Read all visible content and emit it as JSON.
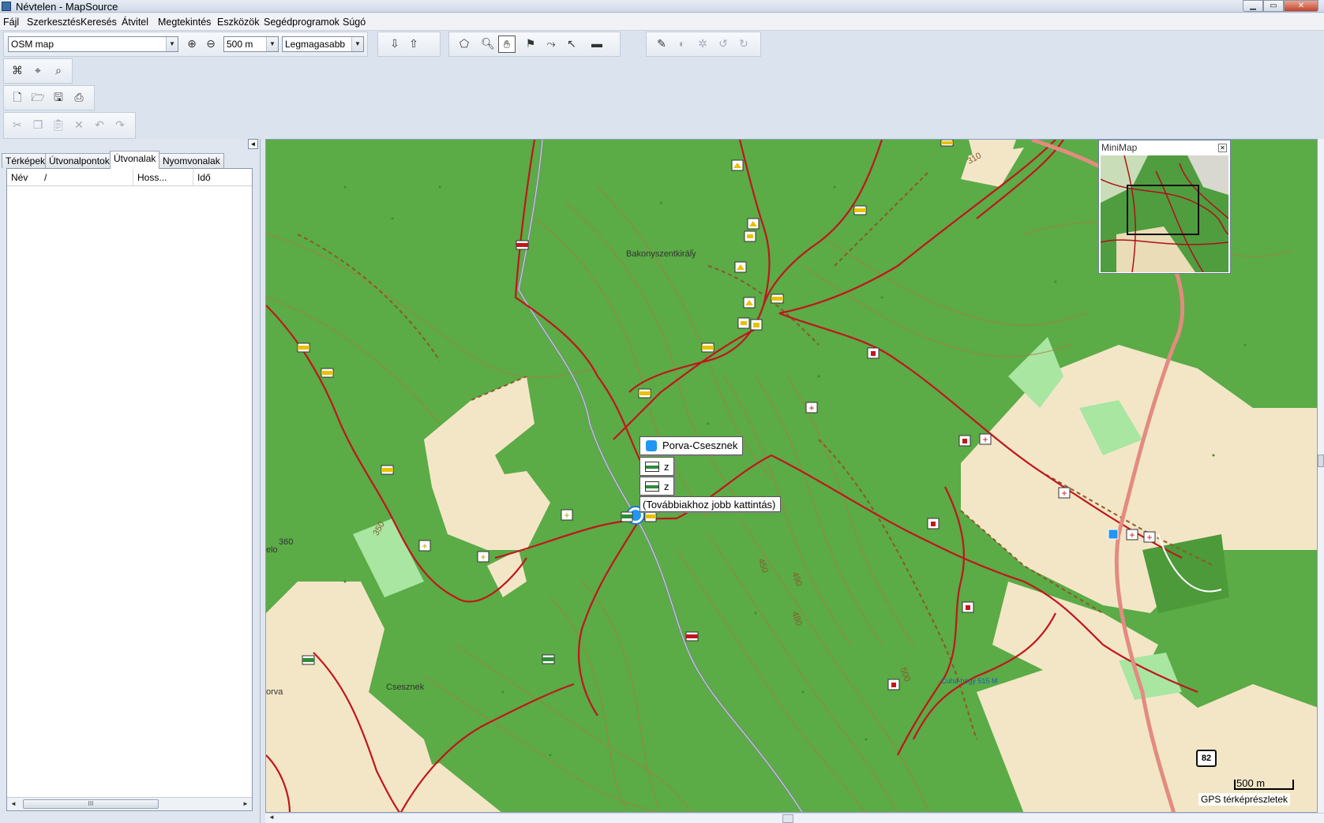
{
  "window": {
    "title": "Névtelen - MapSource",
    "min_glyph": "▁",
    "max_glyph": "▭",
    "close_glyph": "✕"
  },
  "menu": [
    "Fájl",
    "Szerkesztés",
    "Keresés",
    "Átvitel",
    "Megtekintés",
    "Eszközök",
    "Segédprogramok",
    "Súgó"
  ],
  "toolbar": {
    "map_product": "OSM map",
    "zoom_level": "500 m",
    "detail_level": "Legmagasabb",
    "combo_arrow": "▼"
  },
  "left_panel": {
    "collapse_glyph": "◄",
    "tabs": [
      "Térképek",
      "Útvonalpontok",
      "Útvonalak",
      "Nyomvonalak"
    ],
    "active_tab": 2,
    "columns": [
      "Név",
      "/",
      "Hoss...",
      "Idő"
    ],
    "hscroll": {
      "left": "◄",
      "right": "►",
      "thumb": "III"
    }
  },
  "map": {
    "labels": {
      "village_1": "Bakonyszentkirály",
      "village_2": "Csesznek",
      "peak": "Cuha-hegy 515 M",
      "elev_310": "310",
      "elev_350": "350",
      "elev_360": "360",
      "elev_450": "450",
      "elev_490": "490",
      "elev_480": "480",
      "elev_500": "500",
      "edge_left_1": "elo",
      "edge_left_2": "orva"
    },
    "popup": {
      "title": "Porva-Csesznek",
      "item1": "z",
      "item2": "z",
      "hint": "(Továbbiakhoz jobb kattintás)"
    },
    "road_number": "82",
    "scale": "500 m",
    "status": "GPS térképrészletek",
    "scroll_left": "◄"
  },
  "minimap": {
    "title": "MiniMap",
    "close_glyph": "✕"
  },
  "colors": {
    "forest": "#5bab46",
    "forest_dark": "#4c9a3a",
    "clearing": "#f3e6c7",
    "meadow": "#a8e6a2",
    "trail": "#c0161c",
    "contour": "#b3773a",
    "river": "#7c8a90"
  }
}
